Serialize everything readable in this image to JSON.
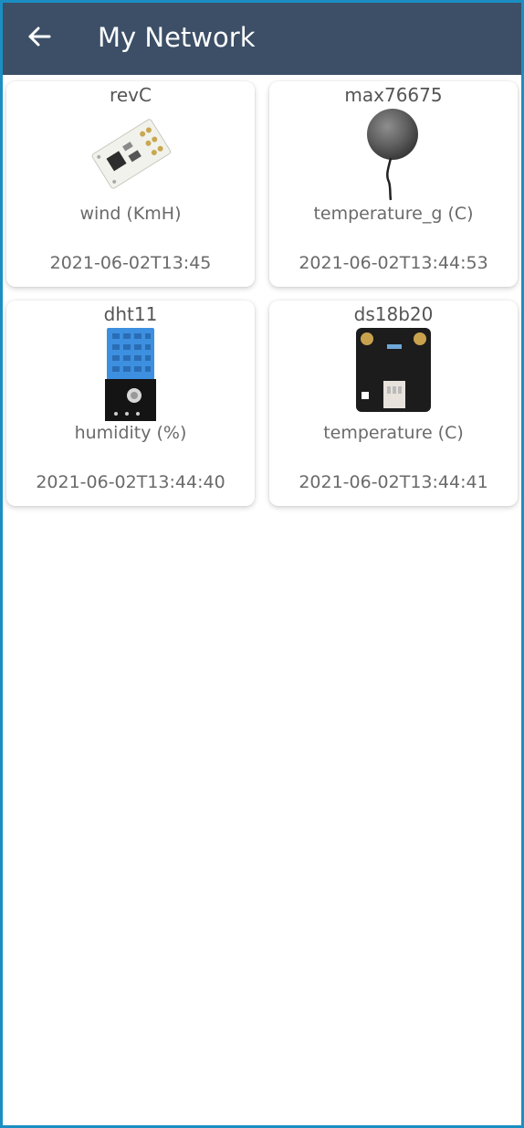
{
  "header": {
    "title": "My Network",
    "back_icon": "arrow-left-icon"
  },
  "colors": {
    "appbar": "#3c4f67",
    "frame_border": "#1b8fc3",
    "text": "#6a6a6a"
  },
  "sensors": [
    {
      "name": "revC",
      "metric": "wind (KmH)",
      "timestamp": "2021-06-02T13:45",
      "image": "wind-sensor-board-image"
    },
    {
      "name": "max76675",
      "metric": "temperature_g (C)",
      "timestamp": "2021-06-02T13:44:53",
      "image": "ground-temperature-probe-image"
    },
    {
      "name": "dht11",
      "metric": "humidity (%)",
      "timestamp": "2021-06-02T13:44:40",
      "image": "dht11-sensor-module-image"
    },
    {
      "name": "ds18b20",
      "metric": "temperature (C)",
      "timestamp": "2021-06-02T13:44:41",
      "image": "ds18b20-sensor-board-image"
    }
  ]
}
